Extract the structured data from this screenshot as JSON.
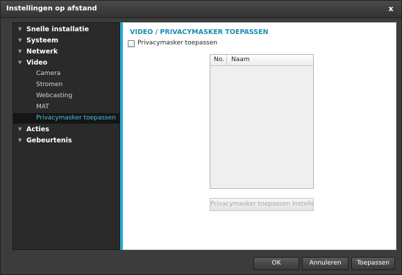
{
  "window": {
    "title": "Instellingen op afstand",
    "close_label": "x"
  },
  "sidebar": {
    "items": [
      {
        "label": "Snelle installatie",
        "level": 1,
        "arrow": "▼"
      },
      {
        "label": "Systeem",
        "level": 1,
        "arrow": "▼"
      },
      {
        "label": "Netwerk",
        "level": 1,
        "arrow": "▼"
      },
      {
        "label": "Video",
        "level": 1,
        "arrow": "▼"
      },
      {
        "label": "Camera",
        "level": 2
      },
      {
        "label": "Stromen",
        "level": 2
      },
      {
        "label": "Webcasting",
        "level": 2
      },
      {
        "label": "MAT",
        "level": 2
      },
      {
        "label": "Privacymasker toepassen",
        "level": 2,
        "selected": true
      },
      {
        "label": "Acties",
        "level": 1,
        "arrow": "▼"
      },
      {
        "label": "Gebeurtenis",
        "level": 1,
        "arrow": "▼"
      }
    ]
  },
  "main": {
    "section_title": "VIDEO / PRIVACYMASKER TOEPASSEN",
    "checkbox_label": "Privacymasker toepassen",
    "checkbox_checked": false,
    "list": {
      "columns": [
        "No.",
        "Naam"
      ],
      "rows": []
    },
    "settings_button_label": "Privacymasker toepassen Instelle..."
  },
  "footer": {
    "ok_label": "OK",
    "cancel_label": "Annuleren",
    "apply_label": "Toepassen"
  },
  "colors": {
    "accent": "#29a9cf",
    "selected_text": "#4cc4e0",
    "section_title": "#1a8cb3"
  }
}
